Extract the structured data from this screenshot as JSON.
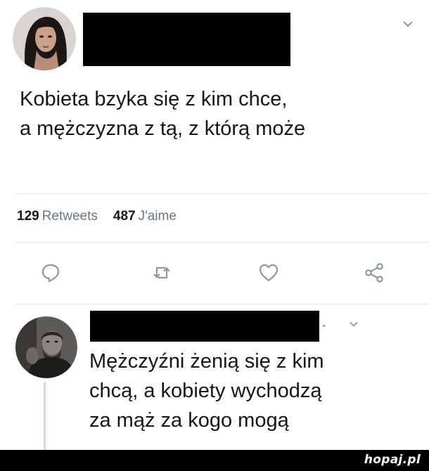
{
  "tweet": {
    "text_lines": [
      "Kobieta bzyka się z kim chce,",
      "a mężczyzna z tą, z którą może"
    ],
    "stats": {
      "retweets_count": "129",
      "retweets_label": "Retweets",
      "likes_count": "487",
      "likes_label": "J'aime"
    },
    "actions": {
      "reply_icon": "reply-icon",
      "retweet_icon": "retweet-icon",
      "like_icon": "heart-icon",
      "share_icon": "share-icon"
    }
  },
  "reply": {
    "text_lines": [
      "Mężczyźni żenią się z kim",
      "chcą, a kobiety wychodzą",
      "za mąż za kogo mogą"
    ]
  },
  "footer": {
    "brand": "hopaj.pl"
  },
  "colors": {
    "text": "#14171a",
    "muted": "#657786",
    "icon": "#8a99a6",
    "divider": "#dde3e7",
    "redaction": "#000000"
  }
}
